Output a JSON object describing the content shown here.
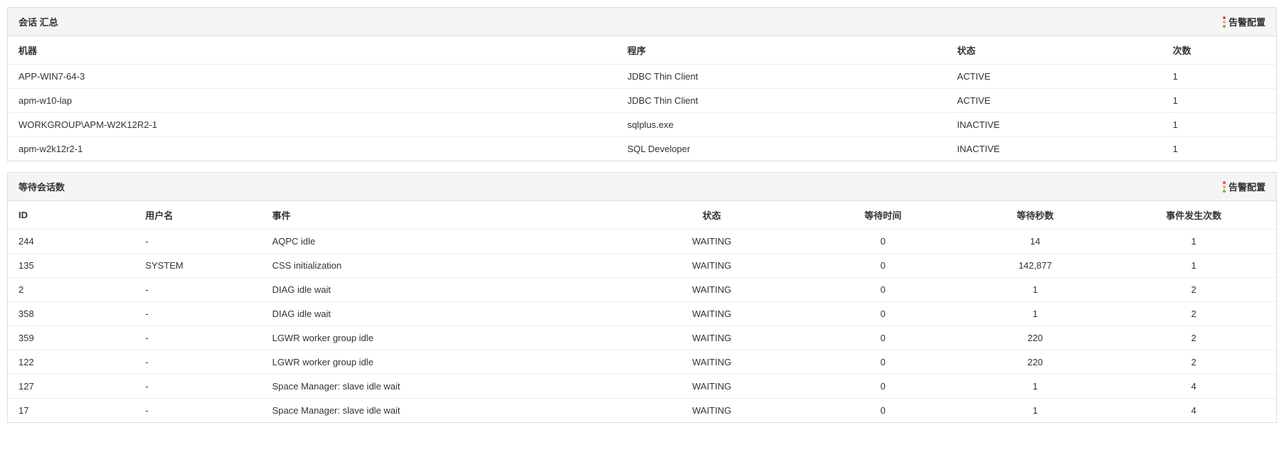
{
  "session_summary": {
    "title": "会话 汇总",
    "alarm_label": "告警配置",
    "columns": {
      "machine": "机器",
      "program": "程序",
      "status": "状态",
      "count": "次数"
    },
    "rows": [
      {
        "machine": "APP-WIN7-64-3",
        "program": "JDBC Thin Client",
        "status": "ACTIVE",
        "count": "1"
      },
      {
        "machine": "apm-w10-lap",
        "program": "JDBC Thin Client",
        "status": "ACTIVE",
        "count": "1"
      },
      {
        "machine": "WORKGROUP\\APM-W2K12R2-1",
        "program": "sqlplus.exe",
        "status": "INACTIVE",
        "count": "1"
      },
      {
        "machine": "apm-w2k12r2-1",
        "program": "SQL Developer",
        "status": "INACTIVE",
        "count": "1"
      }
    ]
  },
  "waiting_sessions": {
    "title": "等待会话数",
    "alarm_label": "告警配置",
    "columns": {
      "id": "ID",
      "username": "用户名",
      "event": "事件",
      "status": "状态",
      "wait_time": "等待时间",
      "wait_seconds": "等待秒数",
      "event_count": "事件发生次数"
    },
    "rows": [
      {
        "id": "244",
        "username": "-",
        "event": "AQPC idle",
        "status": "WAITING",
        "wait_time": "0",
        "wait_seconds": "14",
        "event_count": "1"
      },
      {
        "id": "135",
        "username": "SYSTEM",
        "event": "CSS initialization",
        "status": "WAITING",
        "wait_time": "0",
        "wait_seconds": "142,877",
        "event_count": "1"
      },
      {
        "id": "2",
        "username": "-",
        "event": "DIAG idle wait",
        "status": "WAITING",
        "wait_time": "0",
        "wait_seconds": "1",
        "event_count": "2"
      },
      {
        "id": "358",
        "username": "-",
        "event": "DIAG idle wait",
        "status": "WAITING",
        "wait_time": "0",
        "wait_seconds": "1",
        "event_count": "2"
      },
      {
        "id": "359",
        "username": "-",
        "event": "LGWR worker group idle",
        "status": "WAITING",
        "wait_time": "0",
        "wait_seconds": "220",
        "event_count": "2"
      },
      {
        "id": "122",
        "username": "-",
        "event": "LGWR worker group idle",
        "status": "WAITING",
        "wait_time": "0",
        "wait_seconds": "220",
        "event_count": "2"
      },
      {
        "id": "127",
        "username": "-",
        "event": "Space Manager: slave idle wait",
        "status": "WAITING",
        "wait_time": "0",
        "wait_seconds": "1",
        "event_count": "4"
      },
      {
        "id": "17",
        "username": "-",
        "event": "Space Manager: slave idle wait",
        "status": "WAITING",
        "wait_time": "0",
        "wait_seconds": "1",
        "event_count": "4"
      }
    ]
  }
}
